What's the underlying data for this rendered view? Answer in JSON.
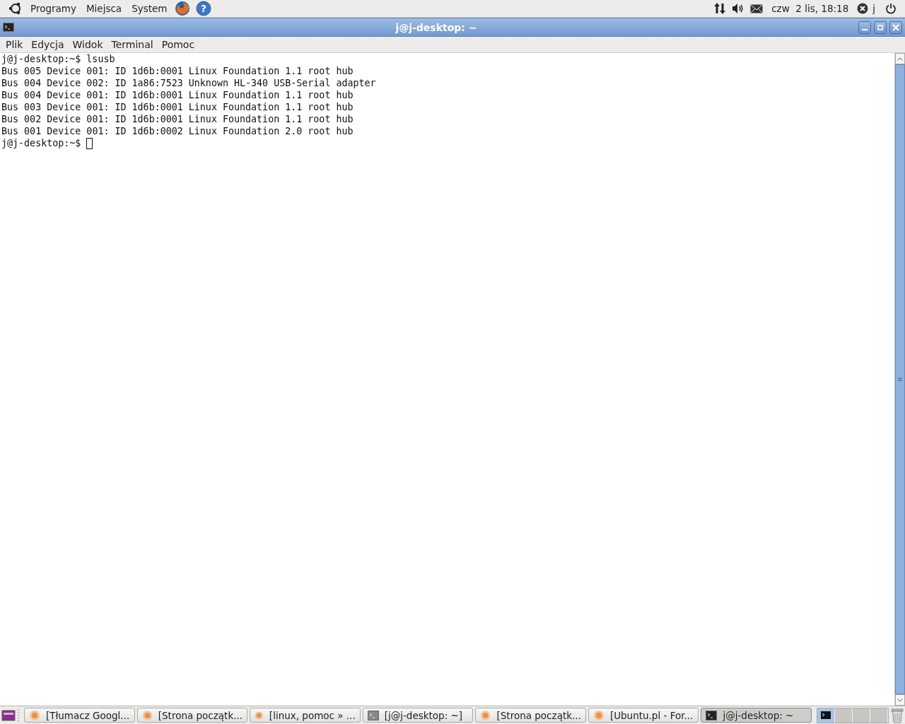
{
  "top_panel": {
    "menus": [
      "Programy",
      "Miejsca",
      "System"
    ],
    "clock": "czw  2 lis, 18:18",
    "user": "j",
    "help_icon": "?"
  },
  "window": {
    "title": "j@j-desktop: ~",
    "menu": [
      "Plik",
      "Edycja",
      "Widok",
      "Terminal",
      "Pomoc"
    ]
  },
  "terminal": {
    "lines": [
      {
        "kind": "prompt",
        "prompt": "j@j-desktop:~$",
        "command": "lsusb"
      },
      {
        "kind": "output",
        "text": "Bus 005 Device 001: ID 1d6b:0001 Linux Foundation 1.1 root hub"
      },
      {
        "kind": "output",
        "text": "Bus 004 Device 002: ID 1a86:7523 Unknown HL-340 USB-Serial adapter"
      },
      {
        "kind": "output",
        "text": "Bus 004 Device 001: ID 1d6b:0001 Linux Foundation 1.1 root hub"
      },
      {
        "kind": "output",
        "text": "Bus 003 Device 001: ID 1d6b:0001 Linux Foundation 1.1 root hub"
      },
      {
        "kind": "output",
        "text": "Bus 002 Device 001: ID 1d6b:0001 Linux Foundation 1.1 root hub"
      },
      {
        "kind": "output",
        "text": "Bus 001 Device 001: ID 1d6b:0002 Linux Foundation 2.0 root hub"
      },
      {
        "kind": "prompt",
        "prompt": "j@j-desktop:~$"
      }
    ]
  },
  "taskbar": {
    "tasks": [
      {
        "kind": "browser",
        "label": "[Tłumacz Googl...",
        "selected": false
      },
      {
        "kind": "browser",
        "label": "[Strona początk...",
        "selected": false
      },
      {
        "kind": "browser",
        "label": "[linux, pomoc » ...",
        "selected": false
      },
      {
        "kind": "terminal",
        "label": "[j@j-desktop: ~]",
        "selected": false
      },
      {
        "kind": "browser",
        "label": "[Strona początk...",
        "selected": false
      },
      {
        "kind": "browser",
        "label": "[Ubuntu.pl - For...",
        "selected": false
      },
      {
        "kind": "terminal",
        "label": "j@j-desktop: ~",
        "selected": true
      }
    ],
    "workspaces": [
      {
        "selected": true
      },
      {
        "selected": false
      },
      {
        "selected": false
      },
      {
        "selected": false
      }
    ]
  }
}
